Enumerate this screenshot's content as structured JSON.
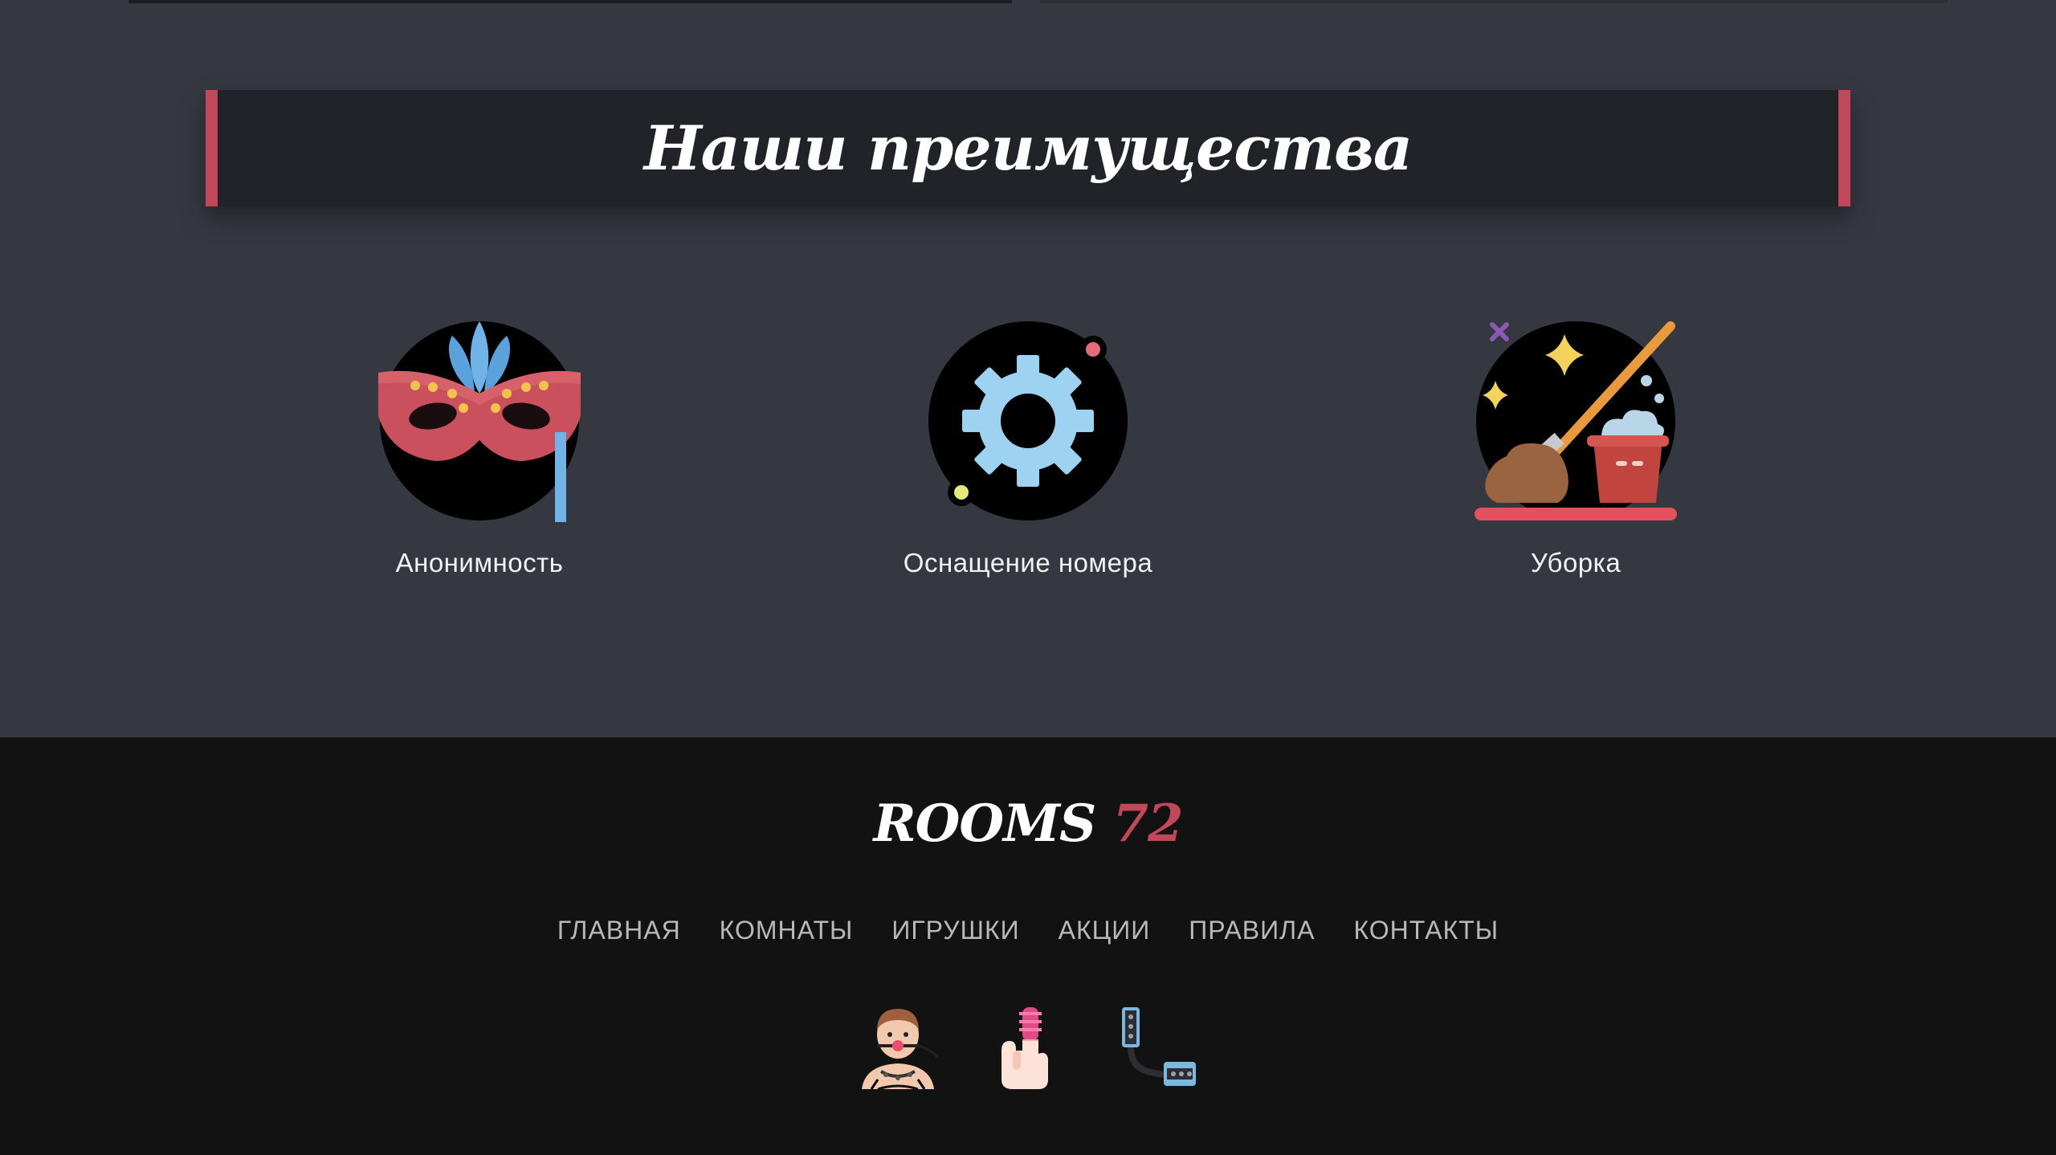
{
  "advantages": {
    "title": "Наши преимущества",
    "items": [
      {
        "label": "Анонимность",
        "icon": "mask-icon"
      },
      {
        "label": "Оснащение номера",
        "icon": "gear-icon"
      },
      {
        "label": "Уборка",
        "icon": "cleaning-icon"
      }
    ]
  },
  "footer": {
    "logo_word": "ROOMS",
    "logo_number": "72",
    "nav": [
      "ГЛАВНАЯ",
      "КОМНАТЫ",
      "ИГРУШКИ",
      "АКЦИИ",
      "ПРАВИЛА",
      "КОНТАКТЫ"
    ],
    "icons": [
      "gagged-person-icon",
      "finger-toy-icon",
      "handcuffs-icon"
    ]
  },
  "colors": {
    "accent": "#c04858",
    "section_bg": "#353841",
    "footer_bg": "#121213"
  }
}
